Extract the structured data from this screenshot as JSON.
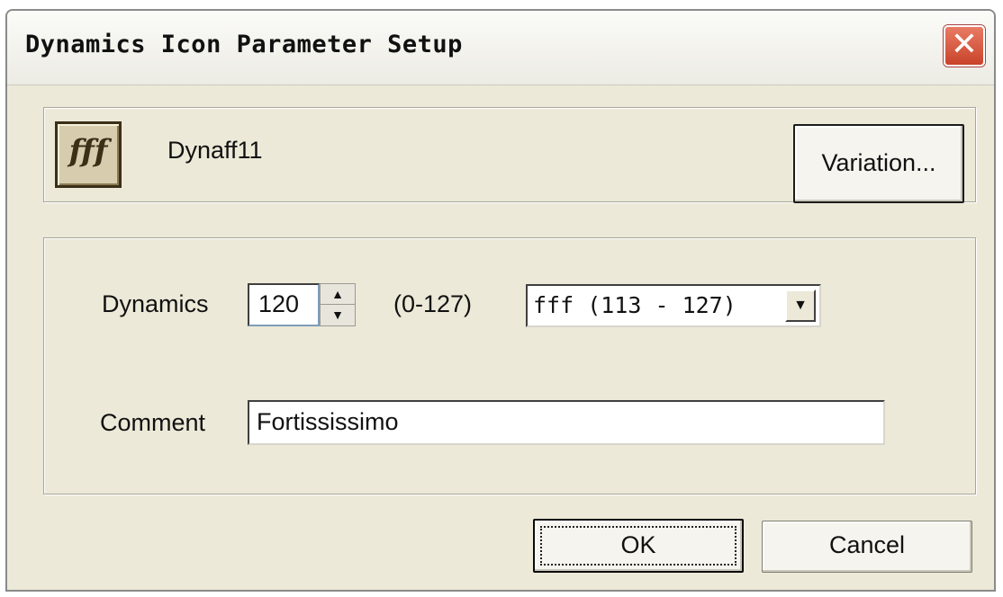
{
  "window": {
    "title": "Dynamics Icon Parameter Setup",
    "close_glyph": "✕"
  },
  "header": {
    "icon_glyph": "fff",
    "icon_name": "Dynaff11",
    "variation_label": "Variation..."
  },
  "dynamics": {
    "label": "Dynamics",
    "value": "120",
    "spin_up": "▲",
    "spin_down": "▼",
    "range": "(0-127)",
    "selected_option": "fff (113 - 127)",
    "dropdown_arrow": "▼"
  },
  "comment": {
    "label": "Comment",
    "value": "Fortississimo"
  },
  "buttons": {
    "ok_label": "OK",
    "cancel_label": "Cancel"
  }
}
